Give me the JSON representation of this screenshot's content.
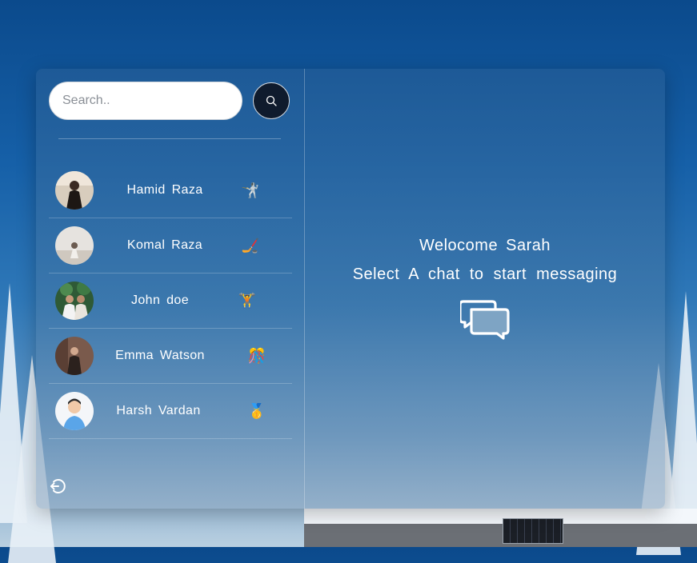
{
  "search": {
    "placeholder": "Search.."
  },
  "contacts": [
    {
      "name": "Hamid  Raza",
      "emoji": "🤺",
      "avatar": "avatar-hamid"
    },
    {
      "name": "Komal  Raza",
      "emoji": "🏒",
      "avatar": "avatar-komal"
    },
    {
      "name": "John  doe",
      "emoji": "🏋️",
      "avatar": "avatar-john"
    },
    {
      "name": "Emma  Watson",
      "emoji": "🎊",
      "avatar": "avatar-emma"
    },
    {
      "name": "Harsh  Vardan",
      "emoji": "🥇",
      "avatar": "avatar-harsh"
    }
  ],
  "main": {
    "welcome": "Welocome  Sarah",
    "subtitle": "Select  A  chat  to  start  messaging"
  },
  "icons": {
    "search": "search-icon",
    "logout": "logout-icon",
    "chat": "chat-bubbles-icon"
  },
  "colors": {
    "search_button": "#0f1b2d",
    "text": "#ffffff"
  }
}
